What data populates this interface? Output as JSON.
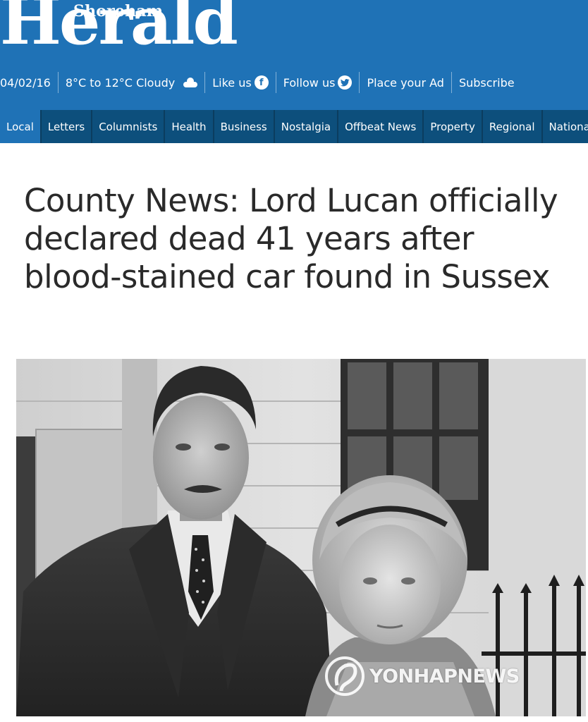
{
  "site": {
    "name_small": "Shoreham",
    "name_big": "Herald"
  },
  "infobar": {
    "date": "04/02/16",
    "weather": "8°C to 12°C Cloudy",
    "like": "Like us",
    "follow": "Follow us",
    "ad": "Place your Ad",
    "subscribe": "Subscribe"
  },
  "nav": {
    "items": [
      "Local",
      "Letters",
      "Columnists",
      "Health",
      "Business",
      "Nostalgia",
      "Offbeat News",
      "Property",
      "Regional",
      "National"
    ],
    "active": "Local"
  },
  "article": {
    "headline": "County News: Lord Lucan officially declared dead 41 years after blood-stained car found in Sussex"
  },
  "watermark": {
    "text": "YONHAPNEWS"
  },
  "colors": {
    "header_blue": "#1f72b6",
    "nav_dark": "#0d4f7c",
    "headline_text": "#2a2a2a"
  },
  "icons": {
    "weather": "cloud-icon",
    "like": "facebook-icon",
    "follow": "twitter-icon"
  }
}
